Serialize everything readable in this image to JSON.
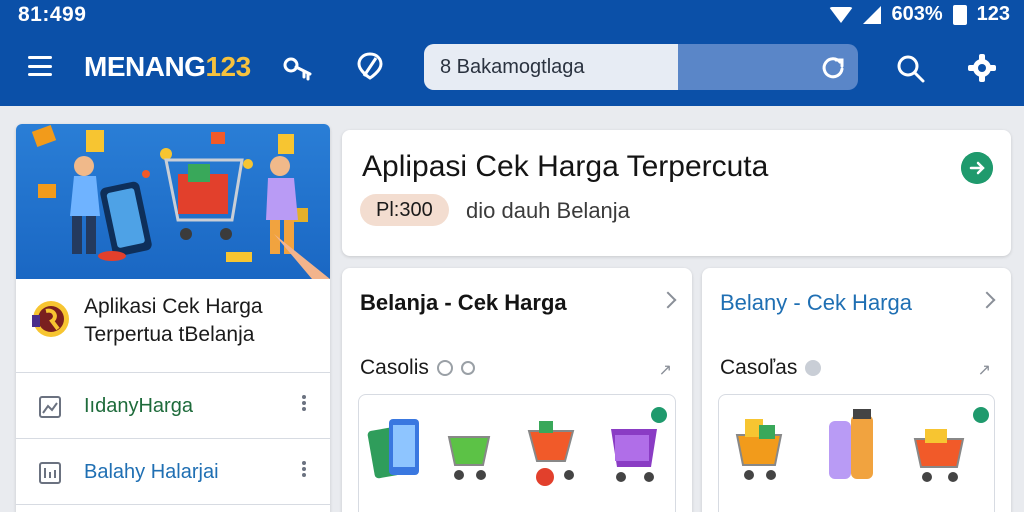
{
  "status_bar": {
    "time": "81:499",
    "battery_label": "603%",
    "clock_right": "123"
  },
  "app_bar": {
    "brand_main": "MENANG",
    "brand_accent": "123",
    "search": {
      "placeholder": "8 Bakamogtlaga"
    },
    "icons": [
      "menu-icon",
      "key-icon",
      "location-pin-icon",
      "refresh-icon",
      "search-icon",
      "settings-gear-icon"
    ]
  },
  "colors": {
    "primary": "#0b50a8",
    "accent": "#f6c23e",
    "success": "#1f9a6d",
    "link_blue": "#1f6fb3",
    "link_green": "#1e6b3b"
  },
  "sidebar": {
    "promo": {
      "line1": "Aplikasi Cek Harga",
      "line2": "Terpertua tBelanja"
    },
    "items": [
      {
        "label": "IıdanyHarga",
        "icon": "image-icon"
      },
      {
        "label": "Balahy Halarjai",
        "icon": "chart-icon"
      }
    ]
  },
  "hero": {
    "title": "Aplipasi Cek Harga Terpercuta",
    "pill": "Pl:300",
    "subtitle": "dio dauh Belanja"
  },
  "cards": [
    {
      "title": "Belanja - Cek Harga",
      "subtitle": "Casolis",
      "title_color": "#141414"
    },
    {
      "title": "Belany - Cek Harga",
      "subtitle": "Casoľas",
      "title_color": "#1f6fb3"
    }
  ]
}
